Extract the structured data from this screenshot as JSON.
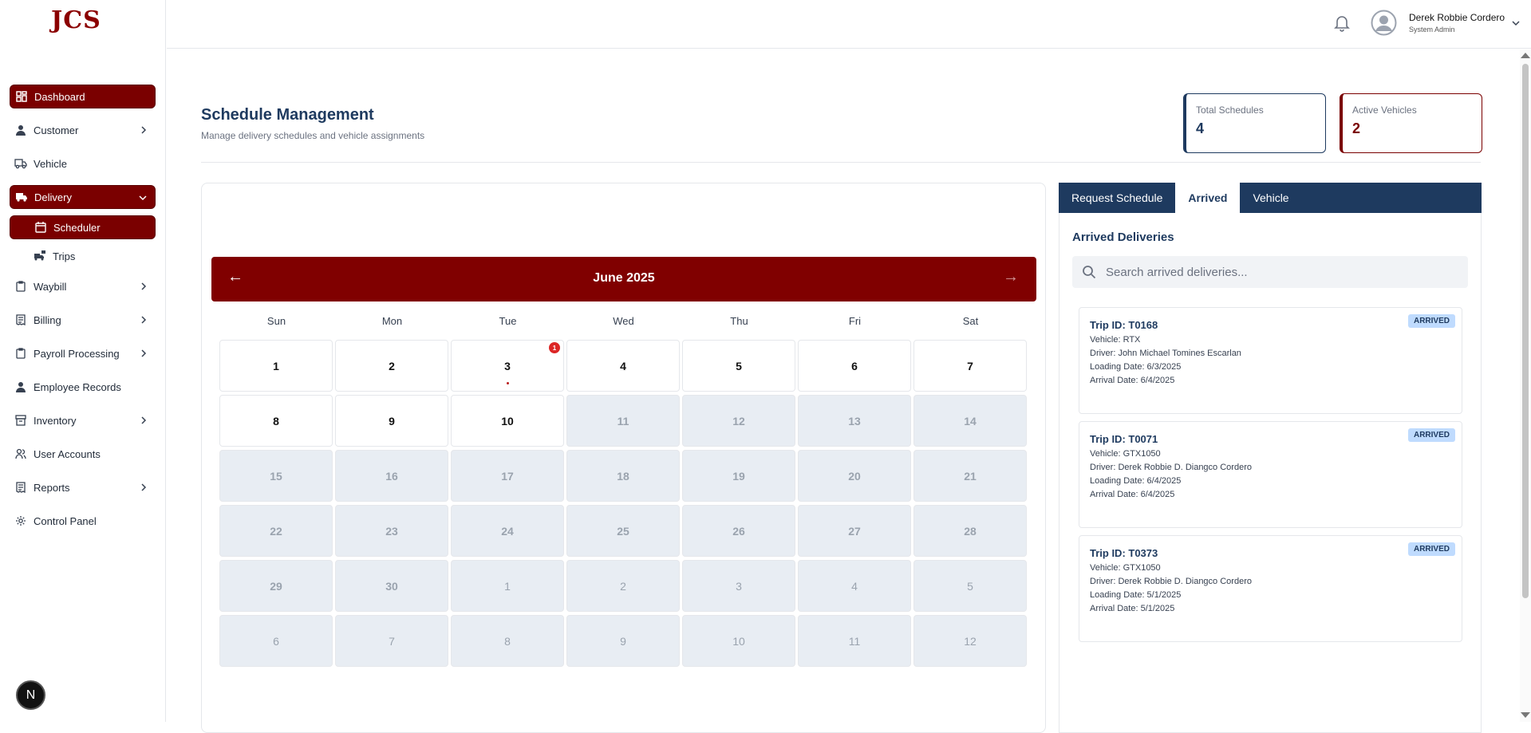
{
  "brand": {
    "logo": "JCS"
  },
  "sidebar": {
    "items": [
      {
        "label": "Dashboard",
        "icon": "dashboard-icon",
        "active": true
      },
      {
        "label": "Customer",
        "icon": "user-icon",
        "chevron": true
      },
      {
        "label": "Vehicle",
        "icon": "truck-icon"
      },
      {
        "label": "Delivery",
        "icon": "delivery-truck-icon",
        "active": true,
        "expanded": true
      },
      {
        "label": "Scheduler",
        "icon": "calendar-icon",
        "active": true,
        "sub": true
      },
      {
        "label": "Trips",
        "icon": "trips-icon",
        "sub": true
      },
      {
        "label": "Waybill",
        "icon": "clipboard-icon",
        "chevron": true
      },
      {
        "label": "Billing",
        "icon": "receipt-icon",
        "chevron": true
      },
      {
        "label": "Payroll Processing",
        "icon": "clipboard-icon",
        "chevron": true
      },
      {
        "label": "Employee Records",
        "icon": "user-icon"
      },
      {
        "label": "Inventory",
        "icon": "archive-icon",
        "chevron": true
      },
      {
        "label": "User Accounts",
        "icon": "users-icon"
      },
      {
        "label": "Reports",
        "icon": "receipt-icon",
        "chevron": true
      },
      {
        "label": "Control Panel",
        "icon": "gear-icon"
      }
    ],
    "next_badge": "N"
  },
  "header": {
    "user_name": "Derek Robbie Cordero",
    "user_role": "System Admin"
  },
  "page": {
    "title": "Schedule Management",
    "subtitle": "Manage delivery schedules and vehicle assignments"
  },
  "stats": {
    "total_label": "Total Schedules",
    "total_value": "4",
    "active_label": "Active Vehicles",
    "active_value": "2"
  },
  "calendar": {
    "month": "June 2025",
    "prev": "←",
    "next": "→",
    "weekdays": [
      "Sun",
      "Mon",
      "Tue",
      "Wed",
      "Thu",
      "Fri",
      "Sat"
    ],
    "days": [
      "1",
      "2",
      "3",
      "4",
      "5",
      "6",
      "7",
      "8",
      "9",
      "10",
      "11",
      "12",
      "13",
      "14",
      "15",
      "16",
      "17",
      "18",
      "19",
      "20",
      "21",
      "22",
      "23",
      "24",
      "25",
      "26",
      "27",
      "28",
      "29",
      "30",
      "1",
      "2",
      "3",
      "4",
      "5",
      "6",
      "7",
      "8",
      "9",
      "10",
      "11",
      "12"
    ],
    "event_day_count": "1"
  },
  "tabs": [
    "Request Schedule",
    "Arrived",
    "Vehicle"
  ],
  "arrived": {
    "title": "Arrived Deliveries",
    "search_placeholder": "Search arrived deliveries...",
    "trips": [
      {
        "id": "Trip ID: T0168",
        "vehicle": "Vehicle: RTX",
        "driver": "Driver: John Michael Tomines Escarlan",
        "loading": "Loading Date: 6/3/2025",
        "arrival": "Arrival Date: 6/4/2025",
        "status": "ARRIVED"
      },
      {
        "id": "Trip ID: T0071",
        "vehicle": "Vehicle: GTX1050",
        "driver": "Driver: Derek Robbie D. Diangco Cordero",
        "loading": "Loading Date: 6/4/2025",
        "arrival": "Arrival Date: 6/4/2025",
        "status": "ARRIVED"
      },
      {
        "id": "Trip ID: T0373",
        "vehicle": "Vehicle: GTX1050",
        "driver": "Driver: Derek Robbie D. Diangco Cordero",
        "loading": "Loading Date: 5/1/2025",
        "arrival": "Arrival Date: 5/1/2025",
        "status": "ARRIVED"
      }
    ]
  }
}
